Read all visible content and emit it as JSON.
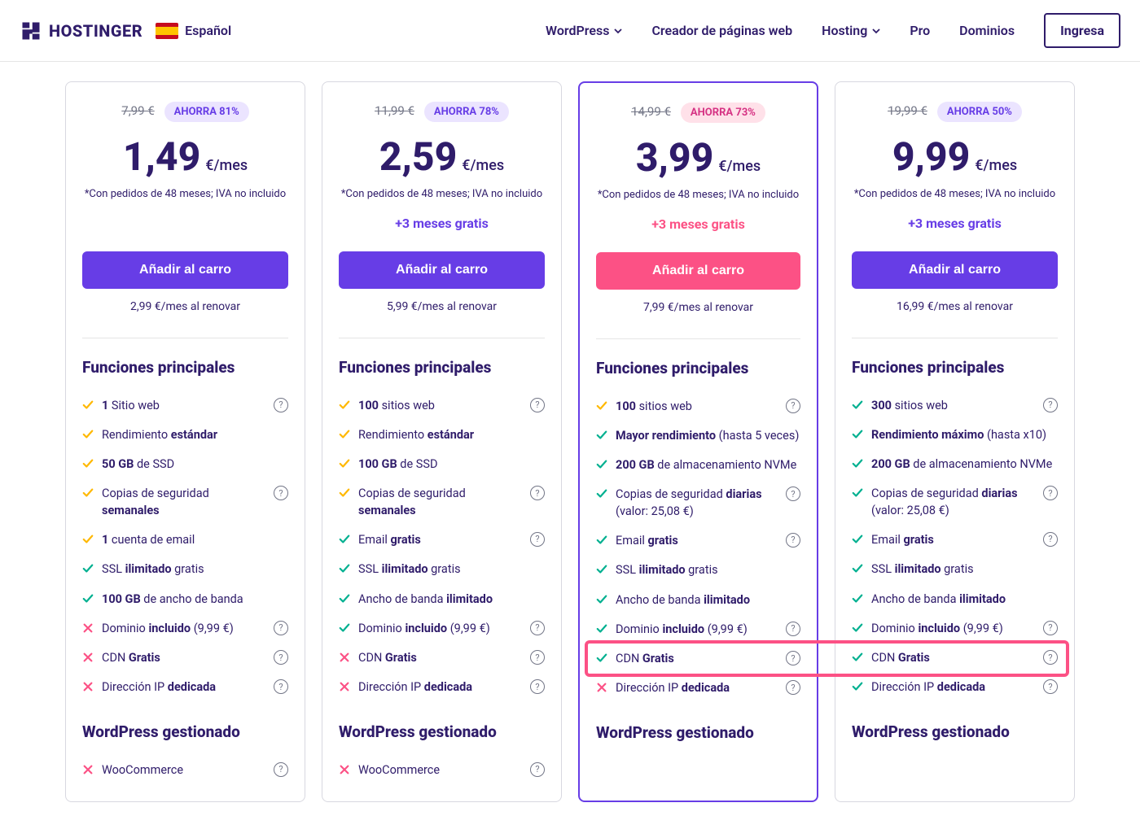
{
  "header": {
    "brand": "HOSTINGER",
    "language": "Español",
    "nav": [
      "WordPress",
      "Creador de páginas web",
      "Hosting",
      "Pro",
      "Dominios"
    ],
    "login": "Ingresa"
  },
  "common": {
    "cta_label": "Añadir al carro",
    "features_title": "Funciones principales",
    "wp_title": "WordPress gestionado",
    "disclaimer": "*Con pedidos de 48 meses; IVA no incluido",
    "per_month": "€/mes",
    "bonus_months": "+3 meses gratis"
  },
  "plans": [
    {
      "old_price": "7,99 €",
      "save": "AHORRA 81%",
      "price": "1,49",
      "bonus": "",
      "renew": "2,99 €/mes al renovar",
      "featured": false,
      "cta_style": "purple",
      "features": [
        {
          "icon": "check-y",
          "html": "<b>1</b> Sitio web",
          "help": true
        },
        {
          "icon": "check-y",
          "html": "Rendimiento <b>estándar</b>",
          "help": false
        },
        {
          "icon": "check-y",
          "html": "<b>50 GB</b> de SSD",
          "help": false
        },
        {
          "icon": "check-y",
          "html": "Copias de seguridad <b>semanales</b>",
          "help": true
        },
        {
          "icon": "check-y",
          "html": "<b>1</b> cuenta de email",
          "help": false
        },
        {
          "icon": "check-g",
          "html": "SSL <b>ilimitado</b> gratis",
          "help": false
        },
        {
          "icon": "check-g",
          "html": "<b>100 GB</b> de ancho de banda",
          "help": false
        },
        {
          "icon": "cross",
          "html": "Dominio <b>incluido</b> (9,99 €)",
          "help": true
        },
        {
          "icon": "cross",
          "html": "CDN <b>Gratis</b>",
          "help": true
        },
        {
          "icon": "cross",
          "html": "Dirección IP <b>dedicada</b>",
          "help": true
        }
      ],
      "wp": [
        {
          "icon": "cross",
          "html": "WooCommerce",
          "help": true
        }
      ]
    },
    {
      "old_price": "11,99 €",
      "save": "AHORRA 78%",
      "price": "2,59",
      "bonus": "+3 meses gratis",
      "renew": "5,99 €/mes al renovar",
      "featured": false,
      "cta_style": "purple",
      "features": [
        {
          "icon": "check-y",
          "html": "<b>100</b> sitios web",
          "help": true
        },
        {
          "icon": "check-y",
          "html": "Rendimiento <b>estándar</b>",
          "help": false
        },
        {
          "icon": "check-y",
          "html": "<b>100 GB</b> de SSD",
          "help": false
        },
        {
          "icon": "check-y",
          "html": "Copias de seguridad <b>semanales</b>",
          "help": true
        },
        {
          "icon": "check-g",
          "html": "Email <b>gratis</b>",
          "help": true
        },
        {
          "icon": "check-g",
          "html": "SSL <b>ilimitado</b> gratis",
          "help": false
        },
        {
          "icon": "check-g",
          "html": "Ancho de banda <b>ilimitado</b>",
          "help": false
        },
        {
          "icon": "check-g",
          "html": "Dominio <b>incluido</b> (9,99 €)",
          "help": true
        },
        {
          "icon": "cross",
          "html": "CDN <b>Gratis</b>",
          "help": true
        },
        {
          "icon": "cross",
          "html": "Dirección IP <b>dedicada</b>",
          "help": true
        }
      ],
      "wp": [
        {
          "icon": "cross",
          "html": "WooCommerce",
          "help": true
        }
      ]
    },
    {
      "old_price": "14,99 €",
      "save": "AHORRA 73%",
      "price": "3,99",
      "bonus": "+3 meses gratis",
      "renew": "7,99 €/mes al renovar",
      "featured": true,
      "pink_accent": true,
      "cta_style": "pink",
      "features": [
        {
          "icon": "check-y",
          "html": "<b>100</b> sitios web",
          "help": true
        },
        {
          "icon": "check-g",
          "html": "<b>Mayor rendimiento</b> (hasta 5 veces)",
          "help": false
        },
        {
          "icon": "check-g",
          "html": "<b>200 GB</b> de almacenamiento NVMe",
          "help": false
        },
        {
          "icon": "check-g",
          "html": "Copias de seguridad <b>diarias</b> (valor: 25,08 €)",
          "help": true
        },
        {
          "icon": "check-g",
          "html": "Email <b>gratis</b>",
          "help": true
        },
        {
          "icon": "check-g",
          "html": "SSL <b>ilimitado</b> gratis",
          "help": false
        },
        {
          "icon": "check-g",
          "html": "Ancho de banda <b>ilimitado</b>",
          "help": false
        },
        {
          "icon": "check-g",
          "html": "Dominio <b>incluido</b> (9,99 €)",
          "help": true
        },
        {
          "icon": "check-g",
          "html": "CDN <b>Gratis</b>",
          "help": true,
          "highlight": true
        },
        {
          "icon": "cross",
          "html": "Dirección IP <b>dedicada</b>",
          "help": true
        }
      ],
      "wp": []
    },
    {
      "old_price": "19,99 €",
      "save": "AHORRA 50%",
      "price": "9,99",
      "bonus": "+3 meses gratis",
      "renew": "16,99 €/mes al renovar",
      "featured": false,
      "cta_style": "purple",
      "features": [
        {
          "icon": "check-g",
          "html": "<b>300</b> sitios web",
          "help": true
        },
        {
          "icon": "check-g",
          "html": "<b>Rendimiento máximo</b> (hasta x10)",
          "help": false
        },
        {
          "icon": "check-g",
          "html": "<b>200 GB</b> de almacenamiento NVMe",
          "help": false
        },
        {
          "icon": "check-g",
          "html": "Copias de seguridad <b>diarias</b> (valor: 25,08 €)",
          "help": true
        },
        {
          "icon": "check-g",
          "html": "Email <b>gratis</b>",
          "help": true
        },
        {
          "icon": "check-g",
          "html": "SSL <b>ilimitado</b> gratis",
          "help": false
        },
        {
          "icon": "check-g",
          "html": "Ancho de banda <b>ilimitado</b>",
          "help": false
        },
        {
          "icon": "check-g",
          "html": "Dominio <b>incluido</b> (9,99 €)",
          "help": true
        },
        {
          "icon": "check-g",
          "html": "CDN <b>Gratis</b>",
          "help": true,
          "highlight": true
        },
        {
          "icon": "check-g",
          "html": "Dirección IP <b>dedicada</b>",
          "help": true
        }
      ],
      "wp": []
    }
  ]
}
